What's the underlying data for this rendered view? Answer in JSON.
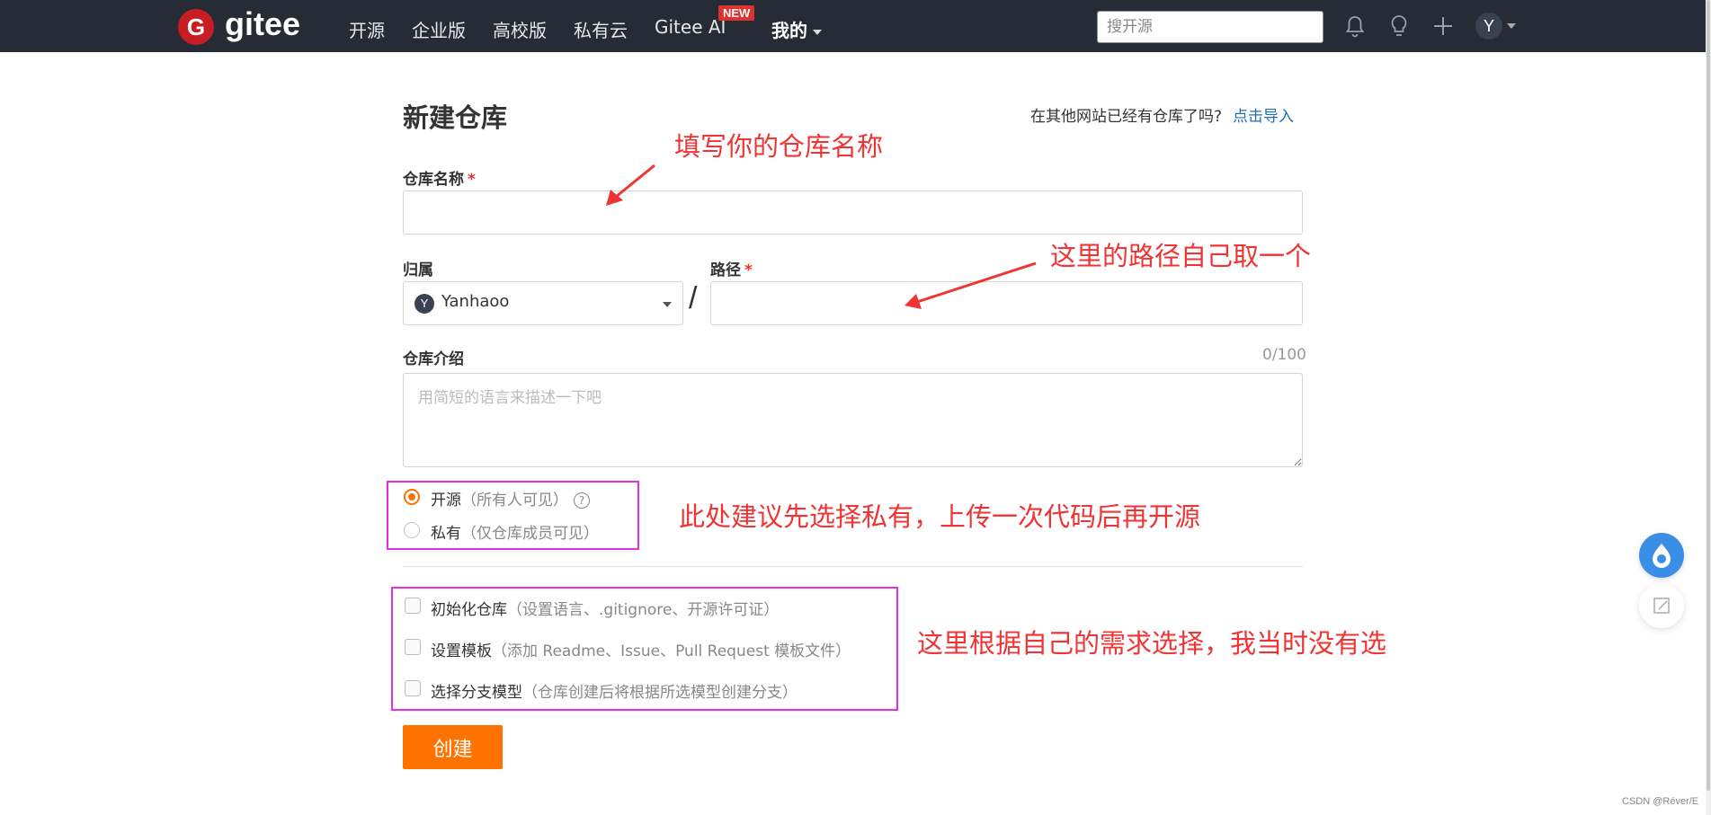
{
  "header": {
    "logo_letter": "G",
    "logo_text": "gitee",
    "nav": [
      "开源",
      "企业版",
      "高校版",
      "私有云",
      "Gitee AI",
      "我的"
    ],
    "new_badge": "NEW",
    "search_placeholder": "搜开源",
    "avatar_letter": "Y"
  },
  "form": {
    "title": "新建仓库",
    "import_hint": "在其他网站已经有仓库了吗?",
    "import_link": "点击导入",
    "repo_name_label": "仓库名称",
    "required_mark": "*",
    "owner_label": "归属",
    "owner_avatar": "Y",
    "owner_name": "Yanhaoo",
    "slash": "/",
    "path_label": "路径",
    "desc_label": "仓库介绍",
    "desc_counter": "0/100",
    "desc_placeholder": "用简短的语言来描述一下吧",
    "visibility": [
      {
        "label": "开源",
        "hint": "（所有人可见）",
        "selected": true
      },
      {
        "label": "私有",
        "hint": "（仅仓库成员可见）",
        "selected": false
      }
    ],
    "help_glyph": "?",
    "options": [
      {
        "label": "初始化仓库",
        "hint": "（设置语言、.gitignore、开源许可证）"
      },
      {
        "label": "设置模板",
        "hint": "（添加 Readme、Issue、Pull Request 模板文件）"
      },
      {
        "label": "选择分支模型",
        "hint": "（仓库创建后将根据所选模型创建分支）"
      }
    ],
    "create_button": "创建"
  },
  "annotations": {
    "name_note": "填写你的仓库名称",
    "path_note": "这里的路径自己取一个",
    "visibility_note": "此处建议先选择私有，上传一次代码后再开源",
    "options_note": "这里根据自己的需求选择，我当时没有选"
  },
  "colors": {
    "topbar": "#262b36",
    "accent": "#fe7300",
    "annotation_red": "#f03333",
    "highlight_magenta": "#e62ee6",
    "link": "#1e6fba"
  },
  "watermark": "CSDN @Réver/E"
}
